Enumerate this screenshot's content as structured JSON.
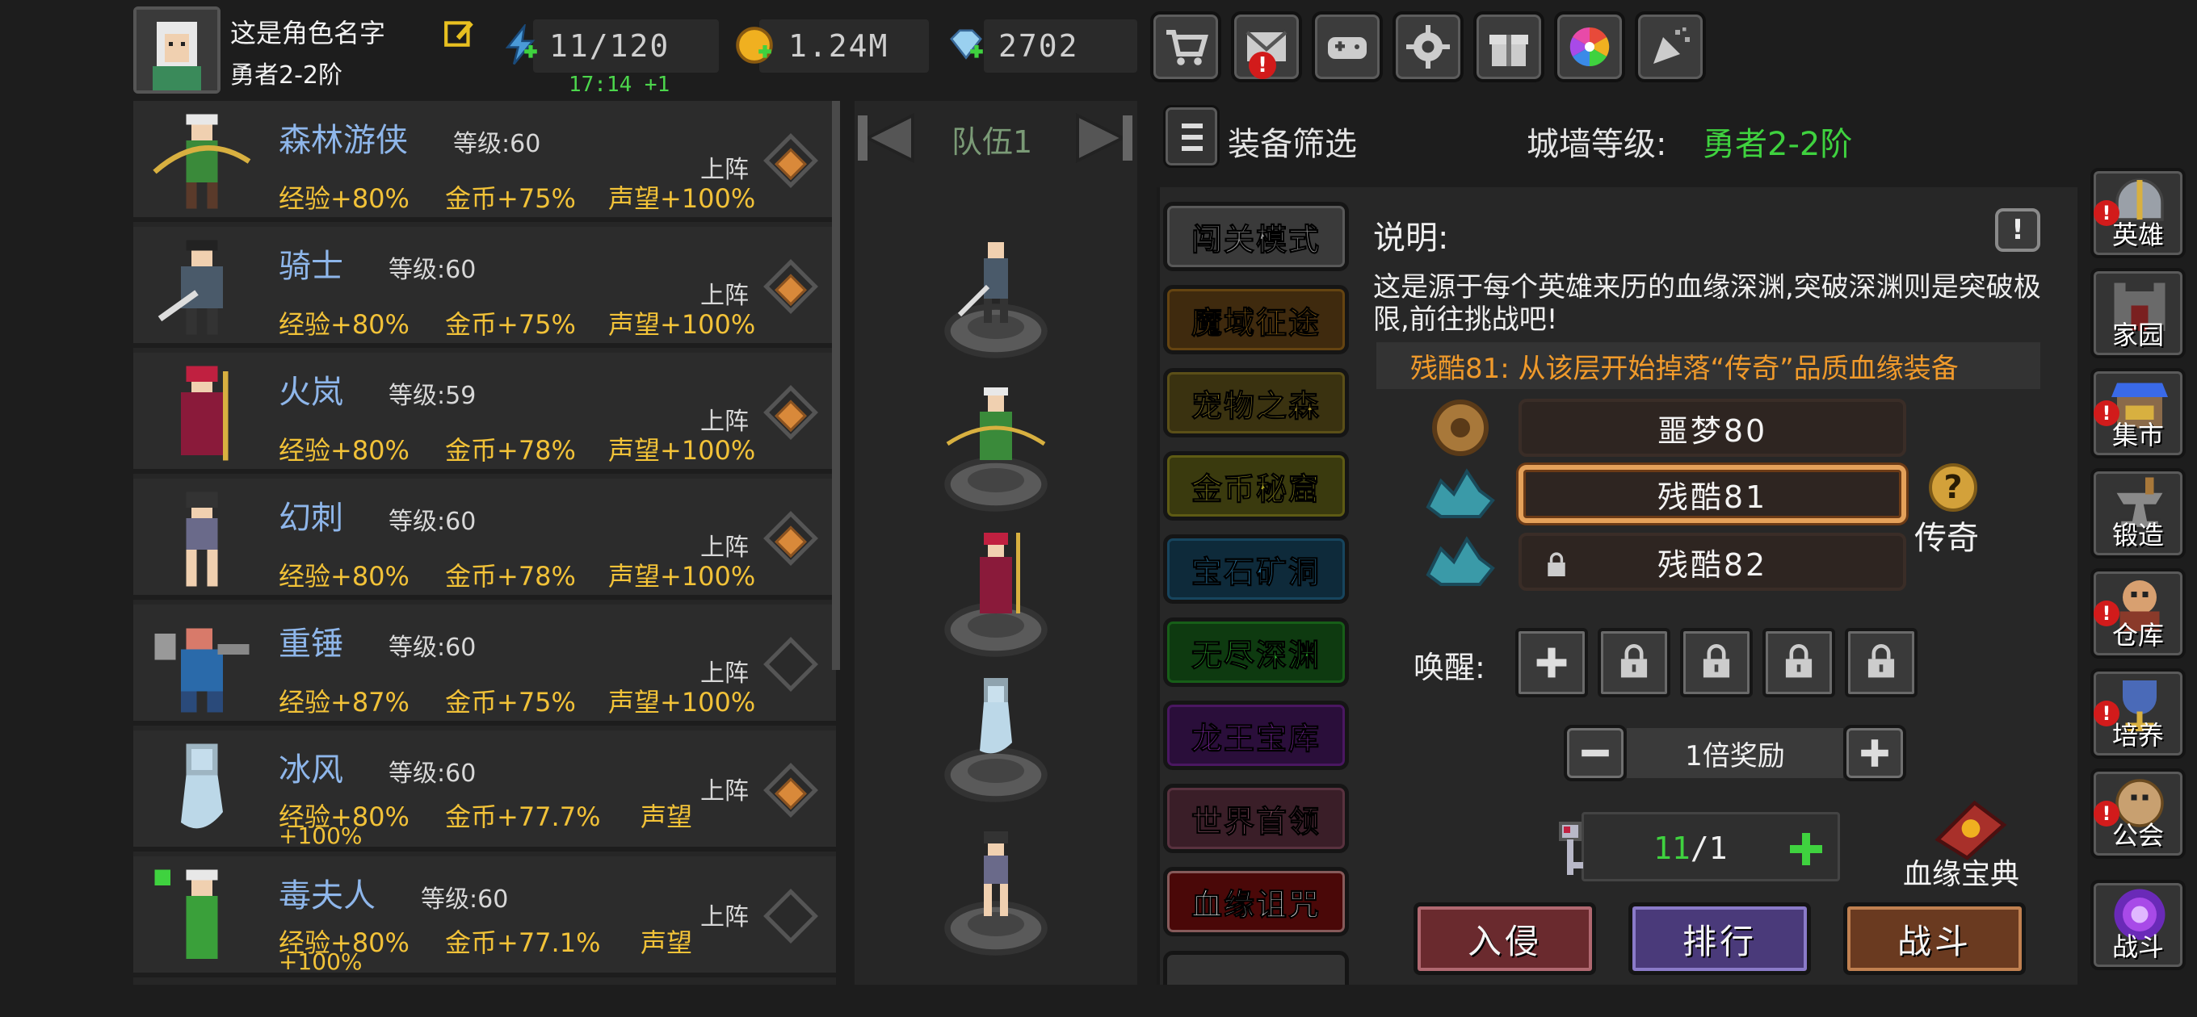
{
  "player": {
    "name": "这是角色名字",
    "rank": "勇者2-2阶",
    "avatar_icon": "elf-portrait-icon"
  },
  "resources": {
    "energy": {
      "value": "11/120",
      "timer": "17:14 +1",
      "icon": "lightning-icon"
    },
    "gold": {
      "value": "1.24M",
      "icon": "gold-coin-icon"
    },
    "gems": {
      "value": "2702",
      "icon": "diamond-icon"
    }
  },
  "top_buttons": [
    {
      "name": "shop",
      "icon": "cart-icon",
      "alert": false
    },
    {
      "name": "mail",
      "icon": "mail-icon",
      "alert": true
    },
    {
      "name": "game",
      "icon": "gamepad-icon",
      "alert": false
    },
    {
      "name": "settings",
      "icon": "gear-icon",
      "alert": false
    },
    {
      "name": "gift",
      "icon": "gift-icon",
      "alert": false
    },
    {
      "name": "wheel",
      "icon": "lucky-wheel-icon",
      "alert": false
    },
    {
      "name": "celebration",
      "icon": "party-popper-icon",
      "alert": false
    }
  ],
  "heroes": [
    {
      "name": "森林游侠",
      "level": "等级:60",
      "exp": "经验+80%",
      "gold": "金币+75%",
      "fame": "声望+100%",
      "deploy": "上阵",
      "deployed": true,
      "color": "#3a8a3a"
    },
    {
      "name": "骑士",
      "level": "等级:60",
      "exp": "经验+80%",
      "gold": "金币+75%",
      "fame": "声望+100%",
      "deploy": "上阵",
      "deployed": true,
      "color": "#4a5a6a"
    },
    {
      "name": "火岚",
      "level": "等级:59",
      "exp": "经验+80%",
      "gold": "金币+78%",
      "fame": "声望+100%",
      "deploy": "上阵",
      "deployed": true,
      "color": "#8a1a3a"
    },
    {
      "name": "幻刺",
      "level": "等级:60",
      "exp": "经验+80%",
      "gold": "金币+78%",
      "fame": "声望+100%",
      "deploy": "上阵",
      "deployed": true,
      "color": "#6a6a8a"
    },
    {
      "name": "重锤",
      "level": "等级:60",
      "exp": "经验+87%",
      "gold": "金币+75%",
      "fame": "声望+100%",
      "deploy": "上阵",
      "deployed": false,
      "color": "#2a6aaa"
    },
    {
      "name": "冰风",
      "level": "等级:60",
      "exp": "经验+80%",
      "gold": "金币+77.7%",
      "fame": "声望",
      "fame2": "+100%",
      "deploy": "上阵",
      "deployed": true,
      "color": "#bcd8e8"
    },
    {
      "name": "毒夫人",
      "level": "等级:60",
      "exp": "经验+80%",
      "gold": "金币+77.1%",
      "fame": "声望",
      "fame2": "+100%",
      "deploy": "上阵",
      "deployed": false,
      "color": "#3aa03a"
    }
  ],
  "team": {
    "label": "队伍1"
  },
  "filter": {
    "label": "装备筛选"
  },
  "wall": {
    "label": "城墙等级:",
    "value": "勇者2-2阶"
  },
  "modes": [
    {
      "label": "闯关模式",
      "bg": "#3a3a3a",
      "fg": "#9a9a9a"
    },
    {
      "label": "魔域征途",
      "bg": "#3f2a0e",
      "fg": "#b07818"
    },
    {
      "label": "宠物之森",
      "bg": "#3a3210",
      "fg": "#a08a2a"
    },
    {
      "label": "金币秘窟",
      "bg": "#3a3a0e",
      "fg": "#a8a020"
    },
    {
      "label": "宝石矿洞",
      "bg": "#0e2a3a",
      "fg": "#2a7aa8"
    },
    {
      "label": "无尽深渊",
      "bg": "#0e3a10",
      "fg": "#2aa82a"
    },
    {
      "label": "龙王宝库",
      "bg": "#2a0e3a",
      "fg": "#8a2ab0"
    },
    {
      "label": "世界首领",
      "bg": "#3a1e28",
      "fg": "#9a5a70"
    },
    {
      "label": "血缘诅咒",
      "bg": "#4a0808",
      "fg": "#ffffff"
    }
  ],
  "description": {
    "title": "说明:",
    "text": "这是源于每个英雄来历的血缘深渊,突破深渊则是突破极限,前往挑战吧!",
    "drop_note": "残酷81: 从该层开始掉落“传奇”品质血缘装备",
    "help": "!"
  },
  "stages": [
    {
      "label": "噩梦80",
      "active": false,
      "locked": false
    },
    {
      "label": "残酷81",
      "active": true,
      "locked": false
    },
    {
      "label": "残酷82",
      "active": false,
      "locked": true
    }
  ],
  "quality": {
    "label": "传奇",
    "icon": "question-mark-icon"
  },
  "awaken": {
    "label": "唤醒:"
  },
  "reward": {
    "value": "1倍奖励"
  },
  "tickets": {
    "current": "11",
    "max": "/1"
  },
  "tome": {
    "label": "血缘宝典"
  },
  "actions": [
    {
      "label": "入侵",
      "bg": "#6a2a2e",
      "border": "#b06870"
    },
    {
      "label": "排行",
      "bg": "#4a3a7a",
      "border": "#8a7ac8"
    },
    {
      "label": "战斗",
      "bg": "#6a3a20",
      "border": "#c08050"
    }
  ],
  "side_menu": [
    {
      "label": "英雄",
      "alert": true
    },
    {
      "label": "家园",
      "alert": false
    },
    {
      "label": "集市",
      "alert": true
    },
    {
      "label": "锻造",
      "alert": false
    },
    {
      "label": "仓库",
      "alert": true
    },
    {
      "label": "培养",
      "alert": true
    },
    {
      "label": "公会",
      "alert": true
    },
    {
      "label": "战斗",
      "alert": false
    }
  ]
}
